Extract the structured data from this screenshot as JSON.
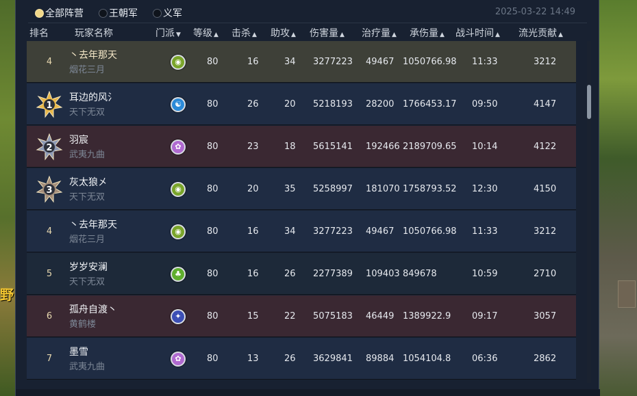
{
  "camp_tabs": [
    {
      "label": "全部阵营",
      "selected": true
    },
    {
      "label": "王朝军",
      "selected": false
    },
    {
      "label": "义军",
      "selected": false
    }
  ],
  "timestamp": "2025-03-22 14:49",
  "columns": {
    "rank": "排名",
    "player": "玩家名称",
    "school": "门派",
    "level": "等级",
    "kills": "击杀",
    "assists": "助攻",
    "damage": "伤害量",
    "healing": "治疗量",
    "damage_taken": "承伤量",
    "battle_time": "战斗时间",
    "contribution": "流光贡献"
  },
  "world_text": "野",
  "school_icons": {
    "yanhua": {
      "name": "sect-icon-yanhua",
      "color": "#7aa52a",
      "glyph": "◉"
    },
    "tianxia": {
      "name": "sect-icon-tianxia",
      "color": "#2b8ad8",
      "glyph": "☯"
    },
    "wuyi": {
      "name": "sect-icon-wuyi",
      "color": "#b06ad0",
      "glyph": "✿"
    },
    "yanhua2": {
      "name": "sect-icon-yanhua",
      "color": "#8aa52a",
      "glyph": "◉"
    },
    "tianxia_green": {
      "name": "sect-icon-tianxia-tree",
      "color": "#5fae2e",
      "glyph": "♣"
    },
    "huanghe": {
      "name": "sect-icon-huanghe",
      "color": "#3c4fb5",
      "glyph": "✦"
    }
  },
  "rows": [
    {
      "rank": "4",
      "medal": null,
      "name": "丶去年那天",
      "server": "烟花三月",
      "school": "yanhua",
      "level": "80",
      "kills": "16",
      "assists": "34",
      "damage": "3277223",
      "healing": "49467",
      "damage_taken": "1050766.98",
      "time": "11:33",
      "contribution": "3212",
      "style": "selected"
    },
    {
      "rank": "1",
      "medal": "gold",
      "name": "耳边的风氵",
      "server": "天下无双",
      "school": "tianxia",
      "level": "80",
      "kills": "26",
      "assists": "20",
      "damage": "5218193",
      "healing": "28200",
      "damage_taken": "1766453.17",
      "time": "09:50",
      "contribution": "4147",
      "style": "blue"
    },
    {
      "rank": "2",
      "medal": "silver",
      "name": "羽宸",
      "server": "武夷九曲",
      "school": "wuyi",
      "level": "80",
      "kills": "23",
      "assists": "18",
      "damage": "5615141",
      "healing": "192466",
      "damage_taken": "2189709.65",
      "time": "10:14",
      "contribution": "4122",
      "style": "red"
    },
    {
      "rank": "3",
      "medal": "bronze",
      "name": "灰太狼㐅",
      "server": "天下无双",
      "school": "yanhua",
      "level": "80",
      "kills": "20",
      "assists": "35",
      "damage": "5258997",
      "healing": "181070",
      "damage_taken": "1758793.52",
      "time": "12:30",
      "contribution": "4150",
      "style": "blue"
    },
    {
      "rank": "4",
      "medal": null,
      "name": "丶去年那天",
      "server": "烟花三月",
      "school": "yanhua",
      "level": "80",
      "kills": "16",
      "assists": "34",
      "damage": "3277223",
      "healing": "49467",
      "damage_taken": "1050766.98",
      "time": "11:33",
      "contribution": "3212",
      "style": "blue"
    },
    {
      "rank": "5",
      "medal": null,
      "name": "岁岁安澜",
      "server": "天下无双",
      "school": "tianxia_green",
      "level": "80",
      "kills": "16",
      "assists": "26",
      "damage": "2277389",
      "healing": "109403",
      "damage_taken": "849678",
      "time": "10:59",
      "contribution": "2710",
      "style": "dark"
    },
    {
      "rank": "6",
      "medal": null,
      "name": "孤舟自渡丶",
      "server": "黄鹤楼",
      "school": "huanghe",
      "level": "80",
      "kills": "15",
      "assists": "22",
      "damage": "5075183",
      "healing": "46449",
      "damage_taken": "1389922.9",
      "time": "09:17",
      "contribution": "3057",
      "style": "red"
    },
    {
      "rank": "7",
      "medal": null,
      "name": "墨雪",
      "server": "武夷九曲",
      "school": "wuyi",
      "level": "80",
      "kills": "13",
      "assists": "26",
      "damage": "3629841",
      "healing": "89884",
      "damage_taken": "1054104.8",
      "time": "06:36",
      "contribution": "2862",
      "style": "blue"
    }
  ],
  "colors": {
    "gold_medal": "#e9b84a",
    "silver_medal": "#8e9ab5",
    "bronze_medal": "#a48d7a"
  }
}
